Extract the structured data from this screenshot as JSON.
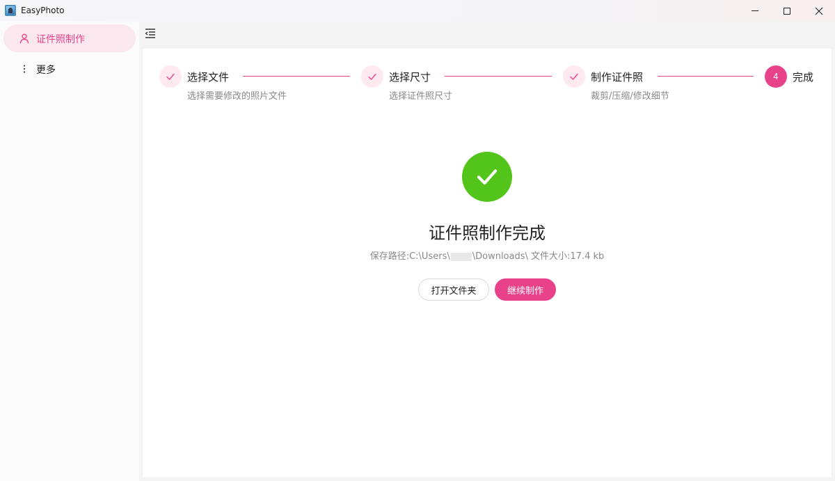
{
  "window": {
    "title": "EasyPhoto",
    "controls": {
      "minimize": "minimize-icon",
      "maximize": "maximize-icon",
      "close": "close-icon"
    }
  },
  "sidebar": {
    "items": [
      {
        "label": "证件照制作",
        "icon": "user-icon",
        "active": true
      },
      {
        "label": "更多",
        "icon": "more-vertical-icon",
        "active": false
      }
    ]
  },
  "toolbar": {
    "menu_icon": "menu-collapse-icon"
  },
  "steps": [
    {
      "title": "选择文件",
      "desc": "选择需要修改的照片文件",
      "status": "done"
    },
    {
      "title": "选择尺寸",
      "desc": "选择证件照尺寸",
      "status": "done"
    },
    {
      "title": "制作证件照",
      "desc": "裁剪/压缩/修改细节",
      "status": "done"
    },
    {
      "title": "完成",
      "number": "4",
      "status": "current"
    }
  ],
  "result": {
    "icon": "success-check-icon",
    "title": "证件照制作完成",
    "path_prefix": "保存路径:C:\\Users\\",
    "path_suffix": "\\Downloads\\ 文件大小:17.4 kb",
    "buttons": {
      "open_folder": "打开文件夹",
      "continue": "继续制作"
    }
  },
  "colors": {
    "accent": "#e8438a",
    "accent_light": "#fde9ef",
    "success": "#52c41a"
  }
}
